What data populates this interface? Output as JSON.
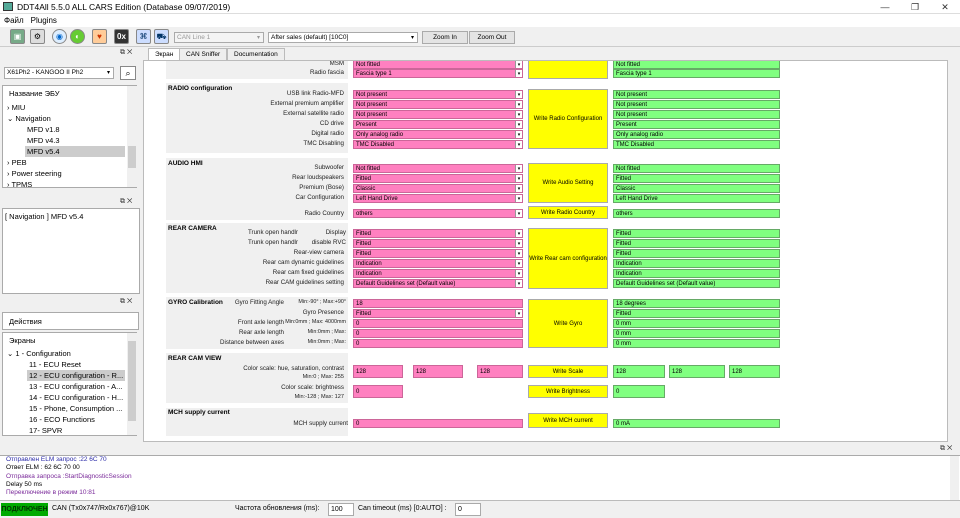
{
  "window": {
    "title": "DDT4All 5.5.0 ALL CARS Edition (Database 09/07/2019)",
    "min": "—",
    "max": "❐",
    "close": "✕"
  },
  "menu": [
    "Файл",
    "Plugins"
  ],
  "toolbar": {
    "icons": [
      "ecu-icon",
      "scan-icon",
      "connect-icon",
      "green-circle-icon",
      "heart-icon",
      "0x-icon",
      "network-icon",
      "car-icon"
    ],
    "can_line": "CAN Line 1",
    "session": "After sales (default) [10C0]",
    "zoom_in": "Zoom In",
    "zoom_out": "Zoom Out"
  },
  "left": {
    "vehicle": "X61Ph2 - KANGOO II Ph2",
    "ecu_header": "Название ЭБУ",
    "ecu_tree": [
      "MIU",
      "Navigation",
      "MFD v1.8",
      "MFD v4.3",
      "MFD v5.4",
      "PEB",
      "Power steering",
      "TPMS"
    ],
    "ecu_sel": "[ Navigation ] MFD v5.4",
    "actions": "Действия",
    "screens_header": "Экраны",
    "screens": [
      "1 - Configuration",
      "11 - ECU Reset",
      "12 - ECU configuration - R...",
      "13 - ECU configuration - A...",
      "14 - ECU configuration - H...",
      "15 - Phone, Consumption ...",
      "16 - ECO Functions",
      "17- SPVR"
    ]
  },
  "tabs": [
    "Экран",
    "CAN Sniffer",
    "Documentation"
  ],
  "screen": {
    "top": {
      "rows": [
        {
          "label": "MSM",
          "value": "Not fitted",
          "result": "Not fitted"
        },
        {
          "label": "Radio fascia",
          "value": "Fascia type 1",
          "result": "Fascia type 1"
        }
      ]
    },
    "radio": {
      "title": "RADIO configuration",
      "button": "Write Radio Configuration",
      "rows": [
        {
          "label": "USB link Radio-MFD",
          "value": "Not present",
          "result": "Not present"
        },
        {
          "label": "External premium amplifier",
          "value": "Not present",
          "result": "Not present"
        },
        {
          "label": "External satellite radio",
          "value": "Not present",
          "result": "Not present"
        },
        {
          "label": "CD drive",
          "value": "Present",
          "result": "Present"
        },
        {
          "label": "Digital radio",
          "value": "Only analog radio",
          "result": "Only analog radio"
        },
        {
          "label": "TMC Disabling",
          "value": "TMC Disabled",
          "result": "TMC Disabled"
        }
      ]
    },
    "audio": {
      "title": "AUDIO HMI",
      "button": "Write Audio Setting",
      "rows": [
        {
          "label": "Subwoofer",
          "value": "Not fitted",
          "result": "Not fitted"
        },
        {
          "label": "Rear loudspeakers",
          "value": "Fitted",
          "result": "Fitted"
        },
        {
          "label": "Premium (Bose)",
          "value": "Classic",
          "result": "Classic"
        },
        {
          "label": "Car Configuration",
          "value": "Left Hand Drive",
          "result": "Left Hand Drive"
        }
      ],
      "country_label": "Radio Country",
      "country_value": "others",
      "country_button": "Write Radio Country",
      "country_result": "others"
    },
    "rearcam": {
      "title": "REAR CAMERA",
      "button": "Write Rear cam configuration",
      "rows": [
        {
          "label": "Trunk open handlr",
          "extra": "Display",
          "value": "Fitted",
          "result": "Fitted"
        },
        {
          "label": "Trunk open handlr",
          "extra": "disable RVC",
          "value": "Fitted",
          "result": "Fitted"
        },
        {
          "label": "Rear-view camera",
          "extra": "",
          "value": "Fitted",
          "result": "Fitted"
        },
        {
          "label": "Rear cam dynamic guidelines",
          "extra": "",
          "value": "Indication",
          "result": "Indication"
        },
        {
          "label": "Rear cam fixed guidelines",
          "extra": "",
          "value": "Indication",
          "result": "Indication"
        },
        {
          "label": "Rear CAM guidelines setting",
          "extra": "",
          "value": "Default Guidelines set (Default value)",
          "result": "Default Guidelines set (Default value)"
        }
      ]
    },
    "gyro": {
      "title": "GYRO Calibration",
      "button": "Write Gyro",
      "rows": [
        {
          "label": "Gyro Fitting Angle",
          "range": "Min:-90° ; Max:+90°",
          "value": "18",
          "result": "18 degrees",
          "drop": false
        },
        {
          "label": "Gyro Presence",
          "range": "",
          "value": "Fitted",
          "result": "Fitted",
          "drop": true
        },
        {
          "label": "Front axle length",
          "range": "Min:0mm ; Max: 4000mm",
          "value": "0",
          "result": "0 mm",
          "drop": false
        },
        {
          "label": "Rear axle length",
          "range": "Min:0mm ; Max:",
          "value": "0",
          "result": "0 mm",
          "drop": false
        },
        {
          "label": "Distance between axes",
          "range": "Min:0mm ; Max:",
          "value": "0",
          "result": "0 mm",
          "drop": false
        }
      ]
    },
    "rcview": {
      "title": "REAR CAM VIEW",
      "scale_label": "Color scale: hue, saturation, contrast",
      "scale_range": "Min:0 ; Max: 255",
      "scale_values": [
        "128",
        "128",
        "128"
      ],
      "scale_button": "Write Scale",
      "scale_results": [
        "128",
        "128",
        "128"
      ],
      "bright_label": "Color scale: brightness",
      "bright_range": "Min:-128 ; Max: 127",
      "bright_value": "0",
      "bright_button": "Write Brightness",
      "bright_result": "0"
    },
    "mch": {
      "title": "MCH supply current",
      "label": "MCH supply current",
      "value": "0",
      "button": "Write MCH current",
      "result": "0 mA"
    }
  },
  "log": [
    {
      "text": "Отправлен ELM запрос :22 6C 70",
      "color": "#2a2aa8"
    },
    {
      "text": "Ответ ELM : 62 6C 70 00",
      "color": "#000000"
    },
    {
      "text": "Отправка запроса :StartDiagnosticSession",
      "color": "#7a2a9a"
    },
    {
      "text": "Delay 50 ms",
      "color": "#000000"
    },
    {
      "text": "Переключение в режим 10:81",
      "color": "#7a2a9a"
    }
  ],
  "status": {
    "connected": "ПОДКЛЮЧЕН",
    "can": "CAN (Tx0x747/Rx0x767)@10K",
    "refresh_label": "Частота обновления (ms):",
    "refresh": "100",
    "timeout_label": "Can timeout (ms) [0:AUTO] :",
    "timeout": "0"
  }
}
